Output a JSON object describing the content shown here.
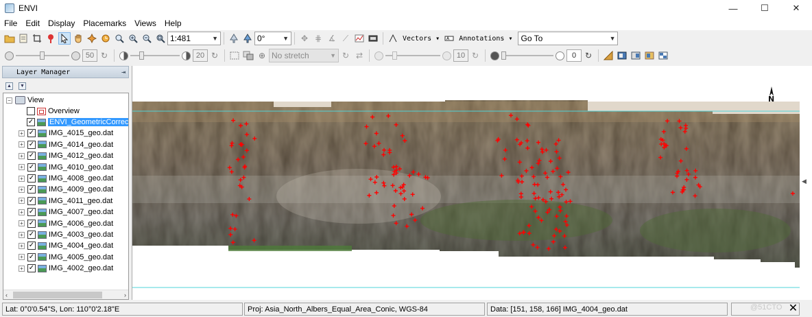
{
  "app": {
    "title": "ENVI"
  },
  "window_controls": {
    "minimize": "—",
    "maximize": "☐",
    "close": "✕"
  },
  "menu": [
    "File",
    "Edit",
    "Display",
    "Placemarks",
    "Views",
    "Help"
  ],
  "toolbar1": {
    "scale": "1:481",
    "rotation": "0°",
    "vectors_label": "Vectors",
    "annotations_label": "Annotations",
    "goto_label": "Go To",
    "icons": [
      "open-icon",
      "data-manager-icon",
      "crop-icon",
      "placemark-icon",
      "select-icon",
      "pan-icon",
      "fly-icon",
      "rotate-icon",
      "zoom-icon",
      "zoom-in-icon",
      "zoom-out-icon",
      "zoom-fit-icon",
      "north-up-icon",
      "rotate-view-icon"
    ]
  },
  "toolbar2": {
    "brightness": "50",
    "contrast": "20",
    "stretch": "No stretch",
    "sharpen": "10",
    "transparency": "0",
    "brightness_level": 0.5,
    "contrast_level": 0.2,
    "transparency_level": 0
  },
  "layer_manager": {
    "title": "Layer Manager",
    "root": "View",
    "overview": "Overview",
    "layers": [
      {
        "label": "ENVI_GeometricCorrection",
        "selected": true
      },
      {
        "label": "IMG_4015_geo.dat"
      },
      {
        "label": "IMG_4014_geo.dat"
      },
      {
        "label": "IMG_4012_geo.dat"
      },
      {
        "label": "IMG_4010_geo.dat"
      },
      {
        "label": "IMG_4008_geo.dat"
      },
      {
        "label": "IMG_4009_geo.dat"
      },
      {
        "label": "IMG_4011_geo.dat"
      },
      {
        "label": "IMG_4007_geo.dat"
      },
      {
        "label": "IMG_4006_geo.dat"
      },
      {
        "label": "IMG_4003_geo.dat"
      },
      {
        "label": "IMG_4004_geo.dat"
      },
      {
        "label": "IMG_4005_geo.dat"
      },
      {
        "label": "IMG_4002_geo.dat"
      }
    ]
  },
  "map": {
    "north_label": "N"
  },
  "status": {
    "latlon": "Lat: 0°0'0.54\"S, Lon: 110°0'2.18\"E",
    "projection": "Proj: Asia_North_Albers_Equal_Area_Conic, WGS-84",
    "pixel_data": "Data: [151, 158, 166]   IMG_4004_geo.dat",
    "close": "✕",
    "watermark": "@51CTO"
  },
  "colors": {
    "accent": "#3399ff",
    "gcp_marker": "#ff0000",
    "boundary_line": "#4fd3d8"
  }
}
